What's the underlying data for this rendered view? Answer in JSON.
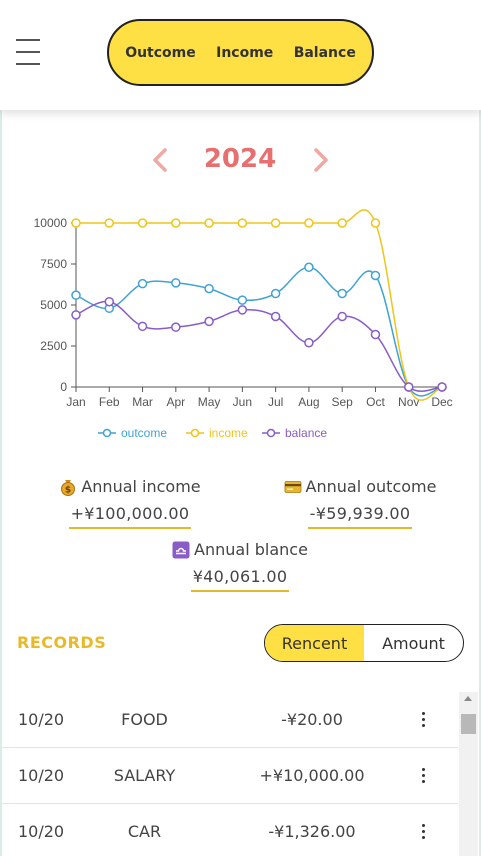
{
  "header": {
    "tabs": [
      {
        "label": "Outcome"
      },
      {
        "label": "Income"
      },
      {
        "label": "Balance"
      }
    ],
    "menu_icon": "hamburger-icon"
  },
  "year": {
    "label": "2024",
    "prev_icon": "chevron-left-icon",
    "next_icon": "chevron-right-icon",
    "color": "#e86f6f"
  },
  "chart_data": {
    "type": "line",
    "categories": [
      "Jan",
      "Feb",
      "Mar",
      "Apr",
      "May",
      "Jun",
      "Jul",
      "Aug",
      "Sep",
      "Oct",
      "Nov",
      "Dec"
    ],
    "yticks": [
      "0",
      "2500",
      "5000",
      "7500",
      "10000"
    ],
    "ylim": [
      0,
      10000
    ],
    "series": [
      {
        "name": "outcome",
        "color": "#3fa3d4",
        "values": [
          5600,
          4800,
          6300,
          6350,
          6000,
          5300,
          5700,
          7300,
          5700,
          6800,
          0,
          0
        ]
      },
      {
        "name": "income",
        "color": "#f0c419",
        "values": [
          10000,
          10000,
          10000,
          10000,
          10000,
          10000,
          10000,
          10000,
          10000,
          10000,
          0,
          0
        ]
      },
      {
        "name": "balance",
        "color": "#8a5cc8",
        "values": [
          4400,
          5200,
          3700,
          3650,
          4000,
          4700,
          4300,
          2700,
          4300,
          3200,
          0,
          0
        ]
      }
    ],
    "legend": "bottom",
    "grid": false
  },
  "summary": {
    "income": {
      "label": "Annual income",
      "value": "+¥100,000.00",
      "icon": "money-bag-icon"
    },
    "outcome": {
      "label": "Annual outcome",
      "value": "-¥59,939.00",
      "icon": "credit-card-icon"
    },
    "balance": {
      "label": "Annual blance",
      "value": "¥40,061.00",
      "icon": "libra-icon"
    }
  },
  "records": {
    "title": "RECORDS",
    "sort_options": [
      {
        "label": "Rencent",
        "active": true
      },
      {
        "label": "Amount",
        "active": false
      }
    ],
    "items": [
      {
        "date": "10/20",
        "category": "FOOD",
        "amount": "-¥20.00"
      },
      {
        "date": "10/20",
        "category": "SALARY",
        "amount": "+¥10,000.00"
      },
      {
        "date": "10/20",
        "category": "CAR",
        "amount": "-¥1,326.00"
      }
    ]
  }
}
